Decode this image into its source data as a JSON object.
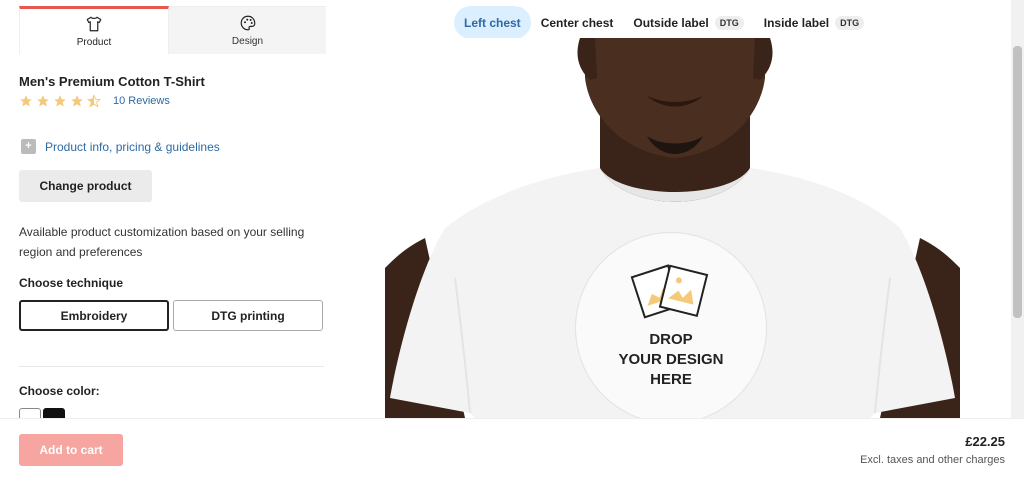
{
  "tabs": [
    {
      "label": "Product",
      "icon": "tshirt-icon"
    },
    {
      "label": "Design",
      "icon": "palette-icon"
    }
  ],
  "product": {
    "title": "Men's Premium Cotton T-Shirt",
    "rating": 4.5,
    "rating_max": 5,
    "reviews_label": "10 Reviews",
    "info_link": "Product info, pricing & guidelines",
    "change_button": "Change product",
    "description": "Available product customization based on your selling region and preferences"
  },
  "technique": {
    "label": "Choose technique",
    "options": [
      "Embroidery",
      "DTG printing"
    ],
    "selected": "Embroidery"
  },
  "color": {
    "label": "Choose color:",
    "swatches": [
      "#ffffff",
      "#111111"
    ]
  },
  "placements": [
    {
      "label": "Left chest",
      "badge": "",
      "active": true
    },
    {
      "label": "Center chest",
      "badge": "",
      "active": false
    },
    {
      "label": "Outside label",
      "badge": "DTG",
      "active": false
    },
    {
      "label": "Inside label",
      "badge": "DTG",
      "active": false
    }
  ],
  "dropzone": {
    "line1": "DROP",
    "line2": "YOUR DESIGN",
    "line3": "HERE"
  },
  "footer": {
    "cart_button": "Add to cart",
    "price": "£22.25",
    "price_note": "Excl. taxes and other charges"
  },
  "colors": {
    "accent": "#e8584f",
    "link": "#2d6aa5",
    "star": "#f5c97a",
    "active_tab_bg": "#dcefff"
  }
}
